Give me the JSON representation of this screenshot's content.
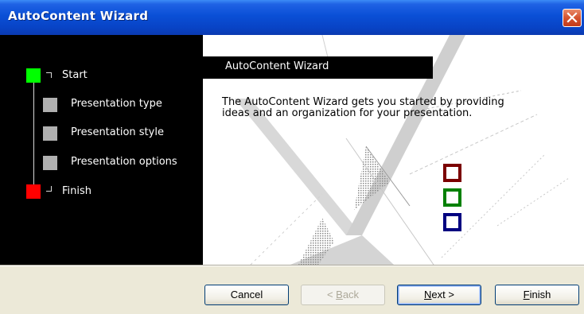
{
  "window": {
    "title": "AutoContent Wizard",
    "close_icon": "close-icon"
  },
  "steps": [
    {
      "label": "Start",
      "state": "current",
      "color": "#00ff00"
    },
    {
      "label": "Presentation type",
      "state": "pending",
      "color": "#b0b0b0"
    },
    {
      "label": "Presentation style",
      "state": "pending",
      "color": "#b0b0b0"
    },
    {
      "label": "Presentation options",
      "state": "pending",
      "color": "#b0b0b0"
    },
    {
      "label": "Finish",
      "state": "final",
      "color": "#ff0000"
    }
  ],
  "panel": {
    "title": "AutoContent Wizard",
    "description": "The AutoContent Wizard gets you started by providing ideas and an organization for your presentation."
  },
  "decor_squares": [
    {
      "color": "#7b0000"
    },
    {
      "color": "#008000"
    },
    {
      "color": "#000080"
    }
  ],
  "buttons": {
    "cancel": "Cancel",
    "back_prefix": "< ",
    "back_key": "B",
    "back_rest": "ack",
    "next_key": "N",
    "next_rest": "ext >",
    "finish_key": "F",
    "finish_rest": "inish",
    "back_enabled": false
  }
}
